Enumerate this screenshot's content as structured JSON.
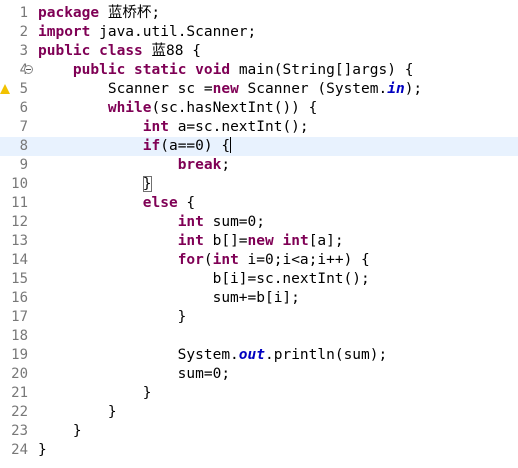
{
  "editor": {
    "lines": [
      {
        "num": "1",
        "tokens": [
          {
            "t": "package",
            "c": "kw"
          },
          {
            "t": " 蓝桥杯;",
            "c": ""
          }
        ]
      },
      {
        "num": "2",
        "tokens": [
          {
            "t": "import",
            "c": "kw"
          },
          {
            "t": " java.util.Scanner;",
            "c": ""
          }
        ]
      },
      {
        "num": "3",
        "tokens": [
          {
            "t": "public",
            "c": "kw"
          },
          {
            "t": " ",
            "c": ""
          },
          {
            "t": "class",
            "c": "kw"
          },
          {
            "t": " 蓝88 {",
            "c": ""
          }
        ]
      },
      {
        "num": "4",
        "fold": true,
        "tokens": [
          {
            "t": "    ",
            "c": ""
          },
          {
            "t": "public",
            "c": "kw"
          },
          {
            "t": " ",
            "c": ""
          },
          {
            "t": "static",
            "c": "kw"
          },
          {
            "t": " ",
            "c": ""
          },
          {
            "t": "void",
            "c": "kw"
          },
          {
            "t": " main(String[]args) {",
            "c": ""
          }
        ]
      },
      {
        "num": "5",
        "warn": true,
        "tokens": [
          {
            "t": "        Scanner sc =",
            "c": ""
          },
          {
            "t": "new",
            "c": "kw"
          },
          {
            "t": " Scanner (System.",
            "c": ""
          },
          {
            "t": "in",
            "c": "field"
          },
          {
            "t": ");",
            "c": ""
          }
        ]
      },
      {
        "num": "6",
        "tokens": [
          {
            "t": "        ",
            "c": ""
          },
          {
            "t": "while",
            "c": "kw"
          },
          {
            "t": "(sc.hasNextInt()) {",
            "c": ""
          }
        ]
      },
      {
        "num": "7",
        "tokens": [
          {
            "t": "            ",
            "c": ""
          },
          {
            "t": "int",
            "c": "kw"
          },
          {
            "t": " a=sc.nextInt();",
            "c": ""
          }
        ]
      },
      {
        "num": "8",
        "current": true,
        "tokens": [
          {
            "t": "            ",
            "c": ""
          },
          {
            "t": "if",
            "c": "kw"
          },
          {
            "t": "(a==0) {",
            "c": ""
          },
          {
            "t": "",
            "c": "cursor"
          }
        ]
      },
      {
        "num": "9",
        "tokens": [
          {
            "t": "                ",
            "c": ""
          },
          {
            "t": "break",
            "c": "kw"
          },
          {
            "t": ";",
            "c": ""
          }
        ]
      },
      {
        "num": "10",
        "tokens": [
          {
            "t": "            ",
            "c": ""
          },
          {
            "t": "}",
            "c": "bracket-box"
          }
        ]
      },
      {
        "num": "11",
        "tokens": [
          {
            "t": "            ",
            "c": ""
          },
          {
            "t": "else",
            "c": "kw"
          },
          {
            "t": " {",
            "c": ""
          }
        ]
      },
      {
        "num": "12",
        "tokens": [
          {
            "t": "                ",
            "c": ""
          },
          {
            "t": "int",
            "c": "kw"
          },
          {
            "t": " sum=0;",
            "c": ""
          }
        ]
      },
      {
        "num": "13",
        "tokens": [
          {
            "t": "                ",
            "c": ""
          },
          {
            "t": "int",
            "c": "kw"
          },
          {
            "t": " b[]=",
            "c": ""
          },
          {
            "t": "new",
            "c": "kw"
          },
          {
            "t": " ",
            "c": ""
          },
          {
            "t": "int",
            "c": "kw"
          },
          {
            "t": "[a];",
            "c": ""
          }
        ]
      },
      {
        "num": "14",
        "tokens": [
          {
            "t": "                ",
            "c": ""
          },
          {
            "t": "for",
            "c": "kw"
          },
          {
            "t": "(",
            "c": ""
          },
          {
            "t": "int",
            "c": "kw"
          },
          {
            "t": " i=0;i<a;i++) {",
            "c": ""
          }
        ]
      },
      {
        "num": "15",
        "tokens": [
          {
            "t": "                    b[i]=sc.nextInt();",
            "c": ""
          }
        ]
      },
      {
        "num": "16",
        "tokens": [
          {
            "t": "                    sum+=b[i];",
            "c": ""
          }
        ]
      },
      {
        "num": "17",
        "tokens": [
          {
            "t": "                }",
            "c": ""
          }
        ]
      },
      {
        "num": "18",
        "tokens": []
      },
      {
        "num": "19",
        "tokens": [
          {
            "t": "                System.",
            "c": ""
          },
          {
            "t": "out",
            "c": "field"
          },
          {
            "t": ".println(sum);",
            "c": ""
          }
        ]
      },
      {
        "num": "20",
        "tokens": [
          {
            "t": "                sum=0;",
            "c": ""
          }
        ]
      },
      {
        "num": "21",
        "tokens": [
          {
            "t": "            }",
            "c": ""
          }
        ]
      },
      {
        "num": "22",
        "tokens": [
          {
            "t": "        }",
            "c": ""
          }
        ]
      },
      {
        "num": "23",
        "tokens": [
          {
            "t": "    }",
            "c": ""
          }
        ]
      },
      {
        "num": "24",
        "tokens": [
          {
            "t": "}",
            "c": ""
          }
        ]
      }
    ]
  },
  "colors": {
    "keyword": "#7f0055",
    "field": "#0000c0",
    "line_number": "#787878",
    "current_line": "#e8f2fe"
  }
}
